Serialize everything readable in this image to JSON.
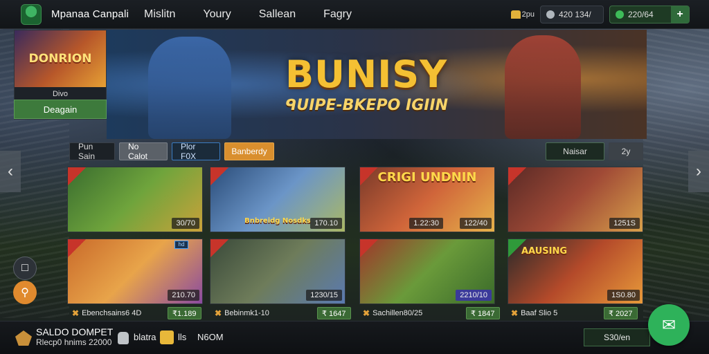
{
  "header": {
    "brand": "Mpanaa Canpali",
    "nav": [
      "Mislitn",
      "Youry",
      "Sallean",
      "Fagry"
    ],
    "notification_label": "2pu",
    "wallet_value": "420 134/",
    "balance_value": "220/64",
    "add_label": "+"
  },
  "promo": {
    "art_text": "DONRION",
    "caption": "Divo",
    "button": "Deagain"
  },
  "hero": {
    "title": "BUNISY",
    "subtitle": "ᑫUIPE-BKEPO IGIIN"
  },
  "filters": {
    "left": [
      "Pun Sain",
      "No Calot",
      "Plor F0X",
      "Banberdy"
    ],
    "right": [
      "Naisar",
      "2y"
    ]
  },
  "tiles": [
    {
      "price": "30/70",
      "label": ""
    },
    {
      "price": "170.10",
      "label": "Bnbreidg Nosdks"
    },
    {
      "price": "122/40",
      "label": "CRIGI UNDNIN",
      "price2": "1.22:30"
    },
    {
      "price": "1251S",
      "label": ""
    },
    {
      "price": "210.70",
      "label": "",
      "badge": "hd"
    },
    {
      "price": "1230/15",
      "label": ""
    },
    {
      "price": "2210/10",
      "label": ""
    },
    {
      "price": "1S0.80",
      "label": "AAUSING"
    }
  ],
  "captions": [
    {
      "text": "Ebenchsains6 4D",
      "price": "₹1.189"
    },
    {
      "text": "Bebinmk1-10",
      "price": "₹ 1647"
    },
    {
      "text": "Sachillen80/25",
      "price": "₹ 1847"
    },
    {
      "text": "Baaf Slio 5",
      "price": "₹ 2027"
    }
  ],
  "bottom": {
    "title": "SALDO DOMPET",
    "subtitle": "Rlecp0 hnims 22000",
    "text1": "blatra",
    "text2": "lls",
    "text3": "N6OM",
    "button": "S30/en"
  },
  "colors": {
    "accent_green": "#2eb25a",
    "accent_orange": "#d98f2e",
    "hero_gold": "#f4c033"
  }
}
